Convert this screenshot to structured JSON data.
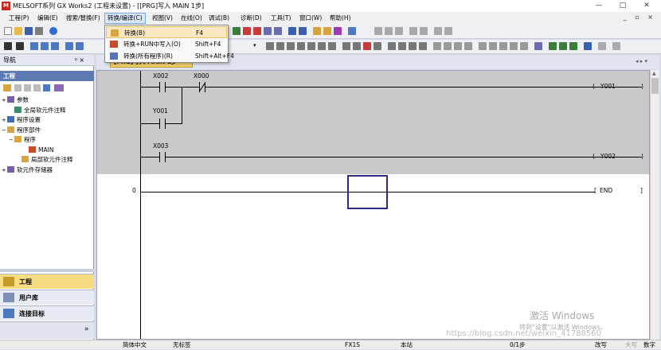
{
  "window": {
    "title": "MELSOFT系列 GX Works2 (工程未设置) - [[PRG]写入 MAIN 1步]",
    "icon_text": "M",
    "controls": [
      "—",
      "□",
      "✕"
    ],
    "mdi_controls": "_ ▫ ×"
  },
  "menu": [
    {
      "label": "工程(P)"
    },
    {
      "label": "编辑(E)"
    },
    {
      "label": "搜索/替换(F)"
    },
    {
      "label": "转换/编译(C)"
    },
    {
      "label": "视图(V)"
    },
    {
      "label": "在线(O)"
    },
    {
      "label": "调试(B)"
    },
    {
      "label": "诊断(D)"
    },
    {
      "label": "工具(T)"
    },
    {
      "label": "窗口(W)"
    },
    {
      "label": "帮助(H)"
    }
  ],
  "dropdown": [
    {
      "label": "转换(B)",
      "key": "F4"
    },
    {
      "label": "转换+RUN中写入(O)",
      "key": "Shift+F4"
    },
    {
      "label": "转换(所有程序)(R)",
      "key": "Shift+Alt+F4"
    }
  ],
  "nav": {
    "title": "导航",
    "pin": "ᵖ ×",
    "subheader": "工程",
    "tree": [
      {
        "label": "参数",
        "indent": 0,
        "expander": "+"
      },
      {
        "label": "全局软元件注释",
        "indent": 1,
        "expander": ""
      },
      {
        "label": "程序设置",
        "indent": 0,
        "expander": "+"
      },
      {
        "label": "程序部件",
        "indent": 0,
        "expander": "−"
      },
      {
        "label": "程序",
        "indent": 1,
        "expander": "−"
      },
      {
        "label": "MAIN",
        "indent": 3,
        "expander": ""
      },
      {
        "label": "局部软元件注释",
        "indent": 2,
        "expander": ""
      },
      {
        "label": "软元件存储器",
        "indent": 0,
        "expander": "+"
      }
    ],
    "tabs": [
      {
        "label": "工程"
      },
      {
        "label": "用户库"
      },
      {
        "label": "连接目标"
      }
    ],
    "more": "»"
  },
  "editor": {
    "tab_title": "[PRG]写入 MAIN 1步",
    "tab_close": "×",
    "nav_arrows": "◂ ▸ ▾",
    "contacts": [
      {
        "label": "X002"
      },
      {
        "label": "X000"
      },
      {
        "label": "Y001"
      },
      {
        "label": "X003"
      }
    ],
    "coils": [
      {
        "label": "Y001"
      },
      {
        "label": "Y002"
      }
    ],
    "step_number": "0",
    "end_label": "END",
    "coil_bracket_open": "(",
    "coil_bracket_close": ")",
    "end_bracket_open": "[",
    "end_bracket_close": "]"
  },
  "status": [
    {
      "label": "简体中文"
    },
    {
      "label": "无标签"
    },
    {
      "label": "FX1S"
    },
    {
      "label": "本站"
    },
    {
      "label": "0/1步"
    },
    {
      "label": "改写"
    },
    {
      "label": "大写"
    },
    {
      "label": "数字"
    }
  ],
  "watermark": {
    "line1": "激活 Windows",
    "line2": "转到\"设置\"以激活 Windows。",
    "url": "https://blog.csdn.net/weixin_41788560"
  },
  "colors": {
    "menu_active": "#d9e8fb",
    "dropdown_hover": "#fbe7c1",
    "nav_subheader": "#5e7ab3",
    "editor_tab": "#f3d36a",
    "ladder_bg": "#c9c9c9",
    "cursor": "#2b2b8a"
  }
}
